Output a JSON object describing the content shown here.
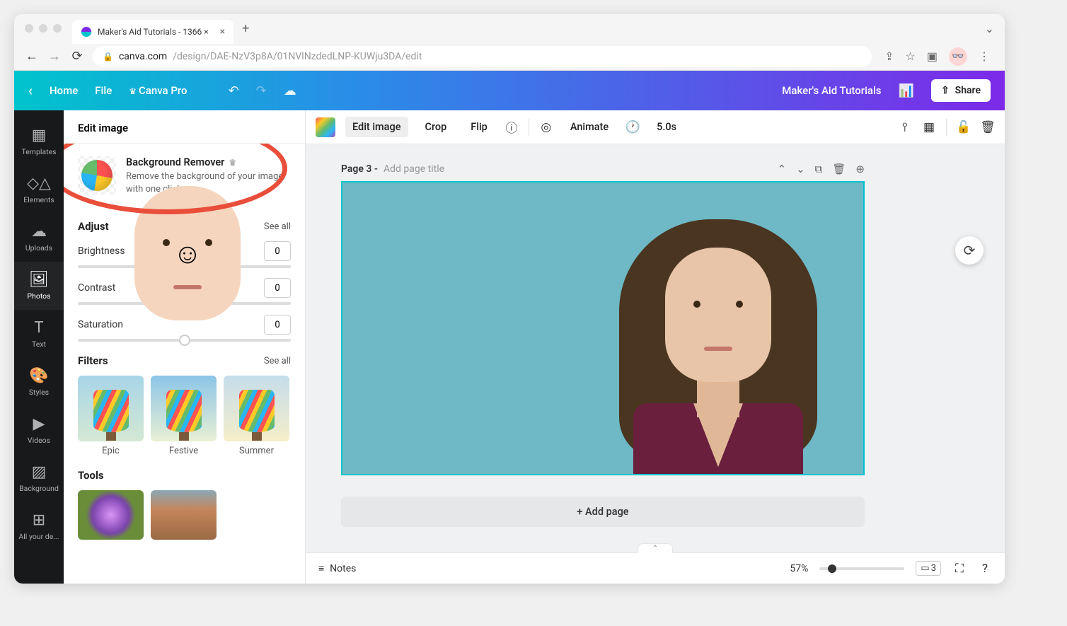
{
  "browser": {
    "tab_title": "Maker's Aid Tutorials - 1366 ×",
    "url_domain": "canva.com",
    "url_path": "/design/DAE-NzV3p8A/01NVlNzdedLNP-KUWju3DA/edit"
  },
  "header": {
    "home": "Home",
    "file": "File",
    "pro": "Canva Pro",
    "project_name": "Maker's Aid Tutorials",
    "share": "Share"
  },
  "rail": {
    "templates": "Templates",
    "elements": "Elements",
    "uploads": "Uploads",
    "photos": "Photos",
    "text": "Text",
    "styles": "Styles",
    "videos": "Videos",
    "background": "Background",
    "all_your": "All your de..."
  },
  "panel": {
    "header": "Edit image",
    "bg_remover_title": "Background Remover",
    "bg_remover_desc": "Remove the background of your image with one click.",
    "adjust": {
      "title": "Adjust",
      "see_all": "See all",
      "brightness": {
        "label": "Brightness",
        "value": "0"
      },
      "contrast": {
        "label": "Contrast",
        "value": "0"
      },
      "saturation": {
        "label": "Saturation",
        "value": "0"
      }
    },
    "filters": {
      "title": "Filters",
      "see_all": "See all",
      "items": [
        "Epic",
        "Festive",
        "Summer"
      ]
    },
    "tools": {
      "title": "Tools"
    }
  },
  "context_toolbar": {
    "edit_image": "Edit image",
    "crop": "Crop",
    "flip": "Flip",
    "animate": "Animate",
    "duration": "5.0s"
  },
  "canvas": {
    "page_label": "Page 3 -",
    "page_title_placeholder": "Add page title",
    "add_page": "+ Add page"
  },
  "bottom": {
    "notes": "Notes",
    "zoom": "57%",
    "page_count": "3"
  }
}
